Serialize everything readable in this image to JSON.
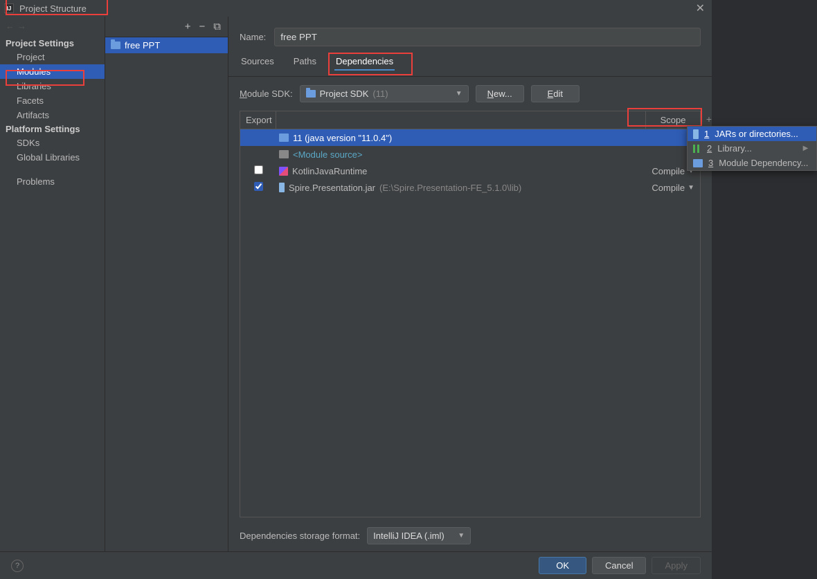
{
  "title": "Project Structure",
  "nav": {
    "back": "←",
    "fwd": "→",
    "project_settings": "Project Settings",
    "items1": [
      "Project",
      "Modules",
      "Libraries",
      "Facets",
      "Artifacts"
    ],
    "platform_settings": "Platform Settings",
    "items2": [
      "SDKs",
      "Global Libraries"
    ],
    "problems": "Problems"
  },
  "module_toolbar": {
    "add": "+",
    "remove": "−",
    "copy": "⧉"
  },
  "module_name": "free PPT",
  "name_label": "Name:",
  "name_value": "free PPT",
  "tabs": {
    "sources": "Sources",
    "paths": "Paths",
    "deps": "Dependencies"
  },
  "sdk_label_pre": "M",
  "sdk_label_rest": "odule SDK:",
  "sdk_value": "Project SDK",
  "sdk_version": "(11)",
  "new_btn_pre": "N",
  "new_btn_rest": "ew...",
  "edit_btn_pre": "E",
  "edit_btn_rest": "dit",
  "table": {
    "export": "Export",
    "scope": "Scope",
    "rows": [
      {
        "export": false,
        "show_cb": false,
        "icon": "folder",
        "name": "11 (java version \"11.0.4\")",
        "scope": "",
        "selected": true
      },
      {
        "export": false,
        "show_cb": false,
        "icon": "folder-gray",
        "name": "<Module source>",
        "scope": "",
        "cyan": true
      },
      {
        "export": false,
        "show_cb": true,
        "icon": "kt",
        "name": "KotlinJavaRuntime",
        "scope": "Compile"
      },
      {
        "export": true,
        "show_cb": true,
        "icon": "jar",
        "name": "Spire.Presentation.jar",
        "hint": "(E:\\Spire.Presentation-FE_5.1.0\\lib)",
        "scope": "Compile"
      }
    ]
  },
  "side": {
    "add": "+",
    "remove": "−",
    "edit": "✎"
  },
  "storage_label": "Dependencies storage format:",
  "storage_value": "IntelliJ IDEA (.iml)",
  "buttons": {
    "ok": "OK",
    "cancel": "Cancel",
    "apply": "Apply"
  },
  "popup": [
    {
      "num": "1",
      "label": "JARs or directories...",
      "selected": true,
      "icon": "jar"
    },
    {
      "num": "2",
      "label": "Library...",
      "icon": "lib",
      "arrow": true
    },
    {
      "num": "3",
      "label": "Module Dependency...",
      "icon": "folder"
    }
  ],
  "close": "✕"
}
